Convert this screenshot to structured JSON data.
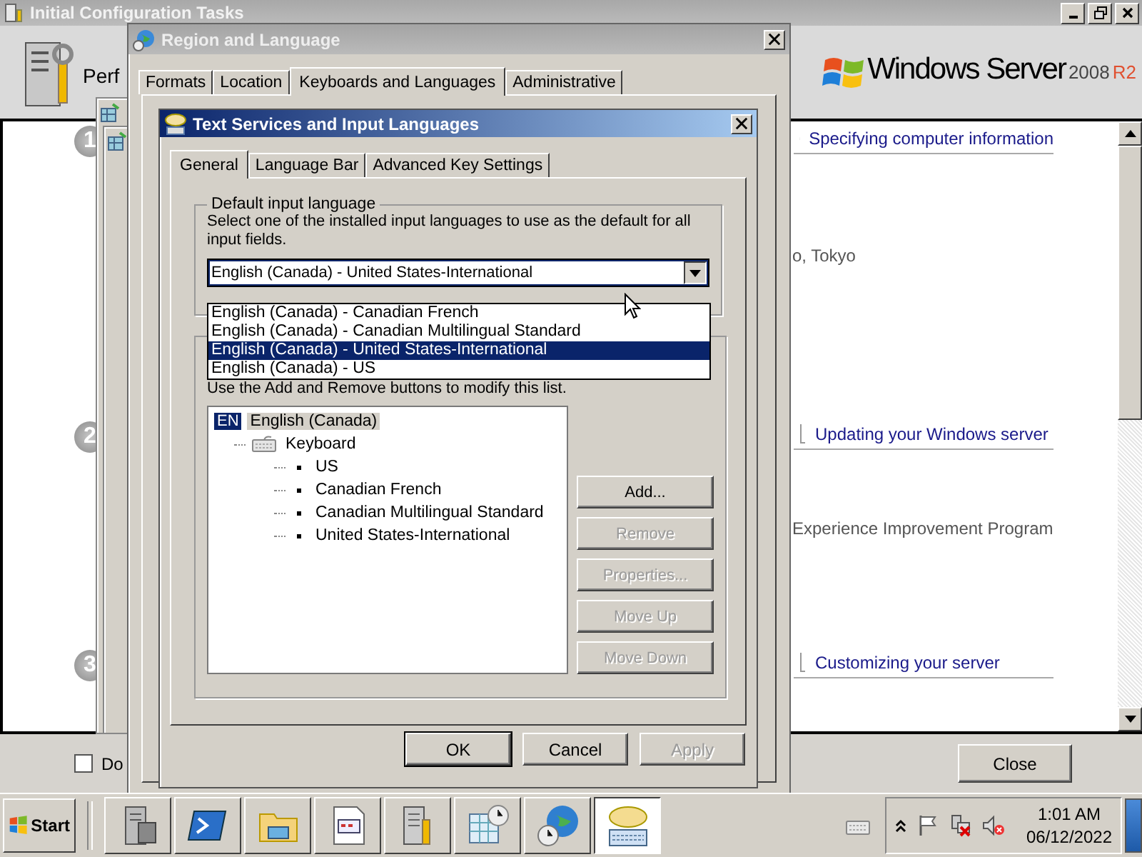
{
  "background_window": {
    "title": "Initial Configuration Tasks",
    "header_text": "Perf",
    "logo": {
      "name": "Windows Server",
      "version": "2008",
      "edition": "R2"
    },
    "steps": [
      {
        "number": "1",
        "heading": "Specifying computer information",
        "detail": "o, Tokyo"
      },
      {
        "number": "2",
        "heading": "Updating your Windows server",
        "detail": "Experience Improvement Program"
      },
      {
        "number": "3",
        "heading": "Customizing your server"
      }
    ],
    "checkbox": {
      "label": "Do",
      "checked": false
    },
    "close_button": "Close"
  },
  "region_window": {
    "title": "Region and Language",
    "tabs": [
      {
        "label": "Formats",
        "selected": false
      },
      {
        "label": "Location",
        "selected": false
      },
      {
        "label": "Keyboards and Languages",
        "selected": true
      },
      {
        "label": "Administrative",
        "selected": false
      }
    ]
  },
  "text_services": {
    "title": "Text Services and Input Languages",
    "tabs": [
      {
        "label": "General",
        "selected": true
      },
      {
        "label": "Language Bar",
        "selected": false
      },
      {
        "label": "Advanced Key Settings",
        "selected": false
      }
    ],
    "default_input": {
      "legend": "Default input language",
      "description": "Select one of the installed input languages to use as the default for all input fields.",
      "value": "English (Canada) - United States-International",
      "expanded": true,
      "options": [
        {
          "label": "English (Canada) - Canadian French",
          "selected": false
        },
        {
          "label": "English (Canada) - Canadian Multilingual Standard",
          "selected": false
        },
        {
          "label": "English (Canada) - United States-International",
          "selected": true
        },
        {
          "label": "English (Canada) - US",
          "selected": false
        }
      ]
    },
    "installed": {
      "note": "Use the Add and Remove buttons to modify this list.",
      "tree": [
        {
          "badge": "EN",
          "label": "English (Canada)",
          "selected": true,
          "children": [
            {
              "label": "Keyboard",
              "selected": false,
              "children": [
                {
                  "label": "US",
                  "selected": false
                },
                {
                  "label": "Canadian French",
                  "selected": false
                },
                {
                  "label": "Canadian Multilingual Standard",
                  "selected": false
                },
                {
                  "label": "United States-International",
                  "selected": false
                }
              ]
            }
          ]
        }
      ],
      "buttons": [
        {
          "label": "Add...",
          "disabled": false
        },
        {
          "label": "Remove",
          "disabled": true
        },
        {
          "label": "Properties...",
          "disabled": true
        },
        {
          "label": "Move Up",
          "disabled": true
        },
        {
          "label": "Move Down",
          "disabled": true
        }
      ]
    },
    "footer_buttons": [
      {
        "label": "OK",
        "disabled": false
      },
      {
        "label": "Cancel",
        "disabled": false
      },
      {
        "label": "Apply",
        "disabled": true
      }
    ]
  },
  "taskbar": {
    "start": "Start",
    "buttons": [
      {
        "kind": "server",
        "selected": false
      },
      {
        "kind": "terminal",
        "selected": false
      },
      {
        "kind": "folder",
        "selected": false
      },
      {
        "kind": "document",
        "selected": false
      },
      {
        "kind": "tools",
        "selected": false
      },
      {
        "kind": "calendar",
        "selected": false
      },
      {
        "kind": "globe",
        "selected": false
      },
      {
        "kind": "keyboard",
        "selected": true
      }
    ],
    "time": "1:01 AM",
    "date": "06/12/2022"
  }
}
